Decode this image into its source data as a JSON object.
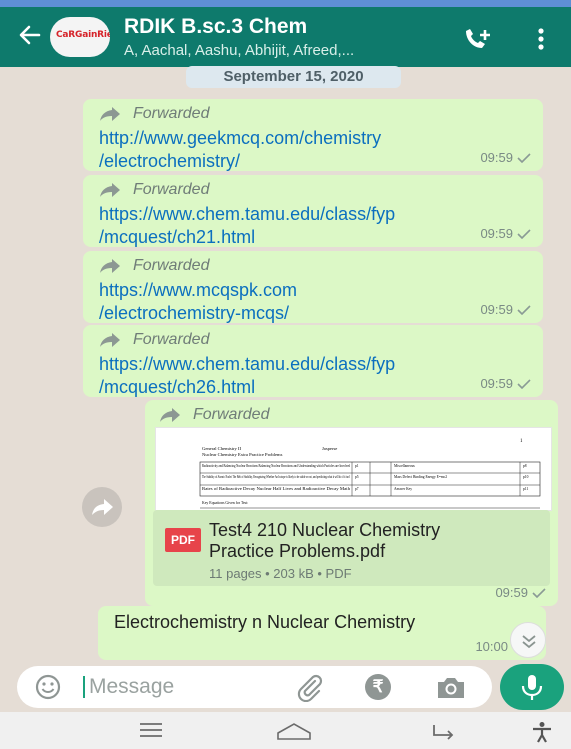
{
  "header": {
    "title": "RDIK B.sc.3 Chem",
    "subtitle": "A, Aachal, Aashu, Abhijit, Afreed,...",
    "avatar_text": "CaRGainRie",
    "colors": {
      "bar": "#0e7a6c",
      "bubble": "#dcf8c6",
      "accent": "#1aa27d"
    }
  },
  "date_chip": "September 15, 2020",
  "messages": [
    {
      "forwarded_label": "Forwarded",
      "line1": "http://www.geekmcq.com/chemistry",
      "line2": "/electrochemistry/",
      "time": "09:59"
    },
    {
      "forwarded_label": "Forwarded",
      "line1": "https://www.chem.tamu.edu/class/fyp",
      "line2": "/mcquest/ch21.html",
      "time": "09:59"
    },
    {
      "forwarded_label": "Forwarded",
      "line1": "https://www.mcqspk.com",
      "line2": "/electrochemistry-mcqs/",
      "time": "09:59"
    },
    {
      "forwarded_label": "Forwarded",
      "line1": "https://www.chem.tamu.edu/class/fyp",
      "line2": "/mcquest/ch26.html",
      "time": "09:59"
    }
  ],
  "document": {
    "forwarded_label": "Forwarded",
    "preview": {
      "page_num": "1",
      "head_left_1": "General Chemistry II",
      "head_left_2": "Nuclear Chemistry   Extra Practice Problems",
      "head_right": "Jasperse",
      "rows": [
        {
          "topic": "Radioactivity and Balancing Nuclear Reactions  Balancing Nuclear Reactions and Understanding which Particles are Involved",
          "page": "p1",
          "topic2": "Miscellaneous",
          "page2": "p8"
        },
        {
          "topic": "The Stability of Atomic Nuclei  The Belt of Stability, Recognizing Whether An Isotope is likely to be stable or not, and predicting what it will do if it isn't",
          "page": "p5",
          "topic2": "Mass Defect  Binding Energy  E=mc2",
          "page2": "p10"
        },
        {
          "topic": "Rates of Radioactive Decay  Nuclear Half Lives and Radioactive Decay Math",
          "page": "p7",
          "topic2": "Answer Key",
          "page2": "p11"
        }
      ],
      "footer": "Key Equations Given for Test:"
    },
    "badge": "PDF",
    "name_line1": "Test4 210 Nuclear Chemistry",
    "name_line2": "Practice Problems.pdf",
    "info": "11 pages • 203 kB • PDF",
    "time": "09:59"
  },
  "last_message": {
    "text": "Electrochemistry n Nuclear Chemistry",
    "time": "10:00"
  },
  "input": {
    "placeholder": "Message",
    "currency_symbol": "₹"
  },
  "icons": [
    "back-arrow-icon",
    "add-call-icon",
    "menu-dots-icon",
    "forward-arrow-icon",
    "share-icon",
    "double-chevron-down-icon",
    "emoji-icon",
    "attach-icon",
    "rupee-icon",
    "camera-icon",
    "mic-icon",
    "menu-lines-icon",
    "home-icon",
    "back-nav-icon",
    "accessibility-icon"
  ]
}
